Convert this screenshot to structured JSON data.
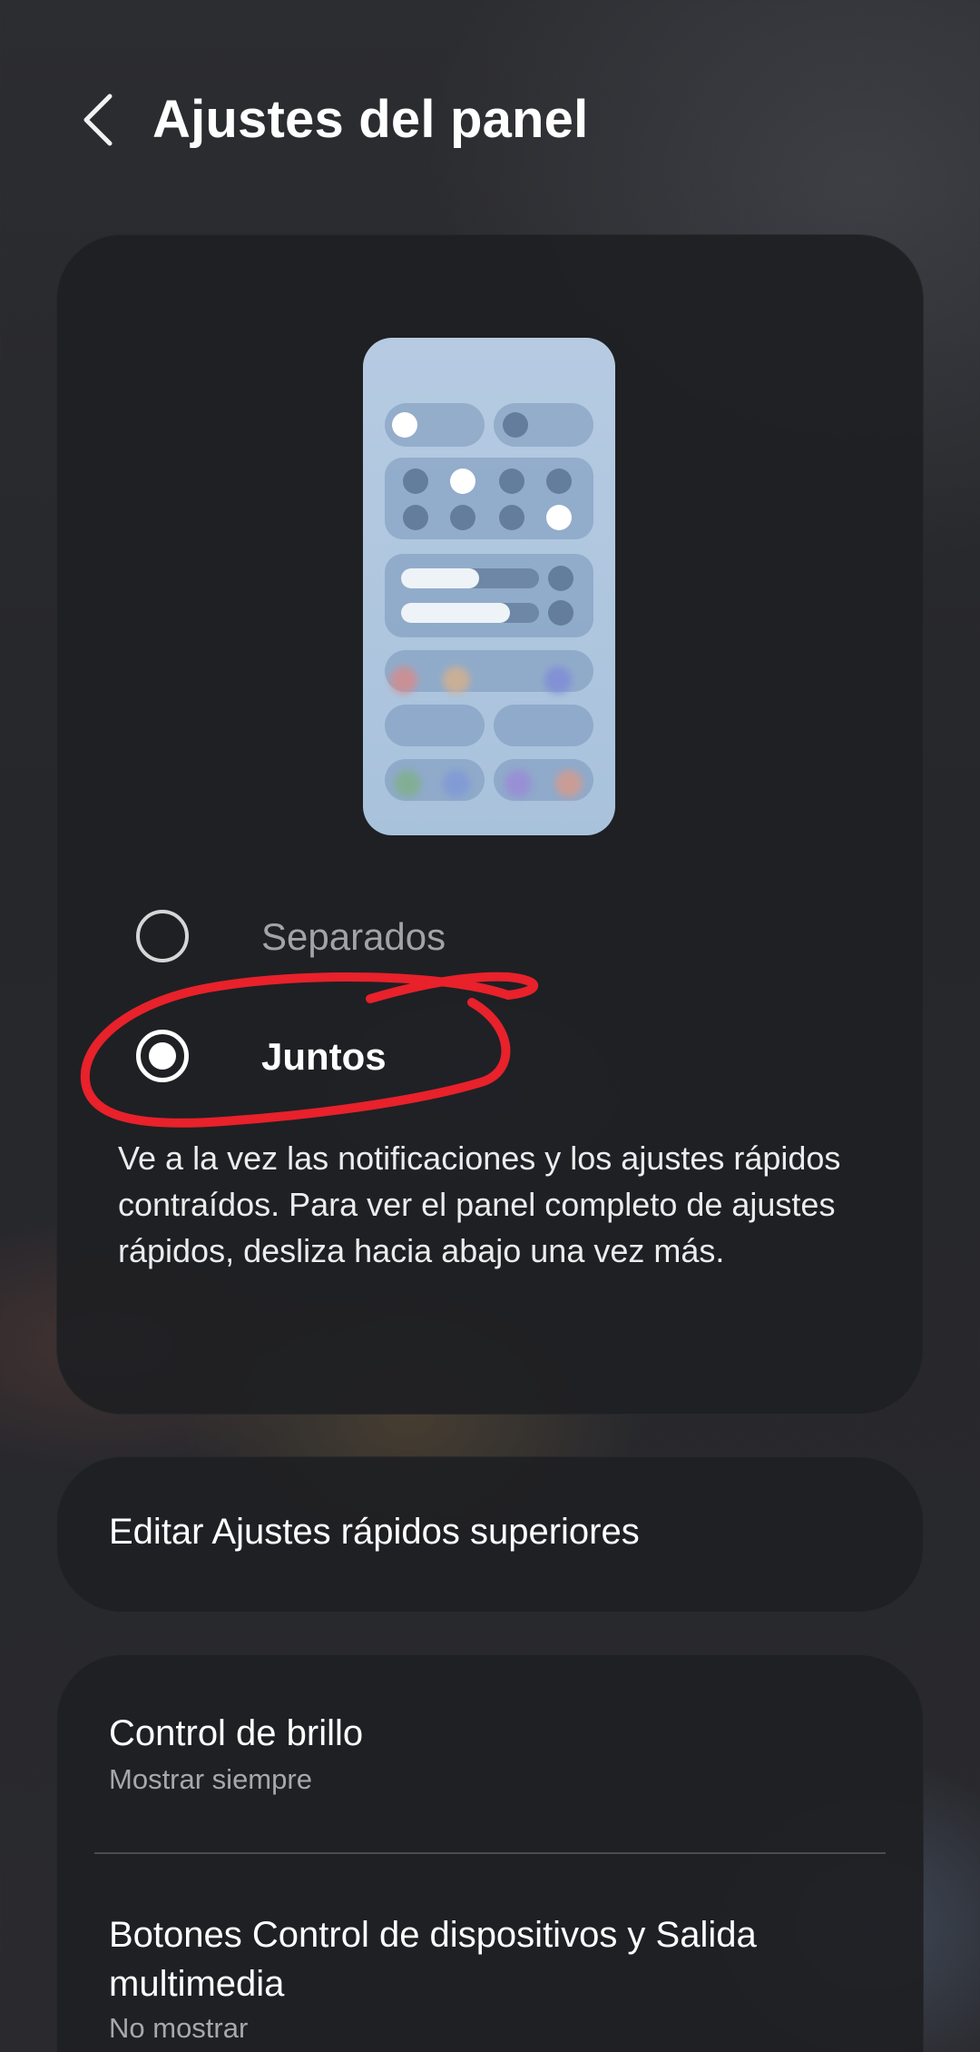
{
  "header": {
    "back_icon": "chevron-left-icon",
    "title": "Ajustes del panel"
  },
  "panel_style": {
    "options": [
      {
        "label": "Separados",
        "selected": false
      },
      {
        "label": "Juntos",
        "selected": true
      }
    ],
    "description": "Ve a la vez las notificaciones y los ajustes rápidos contraídos. Para ver el panel completo de ajustes rápidos, desliza hacia abajo una vez más."
  },
  "edit_item": {
    "label": "Editar Ajustes rápidos superiores"
  },
  "settings_list": [
    {
      "title": "Control de brillo",
      "subtitle": "Mostrar siempre"
    },
    {
      "title": "Botones Control de dispositivos y Salida multimedia",
      "subtitle": "No mostrar"
    }
  ],
  "colors": {
    "background": "#2a2b2f",
    "card": "#1e1f23",
    "preview": "#b6cbe2",
    "annotation": "#e8212b"
  }
}
